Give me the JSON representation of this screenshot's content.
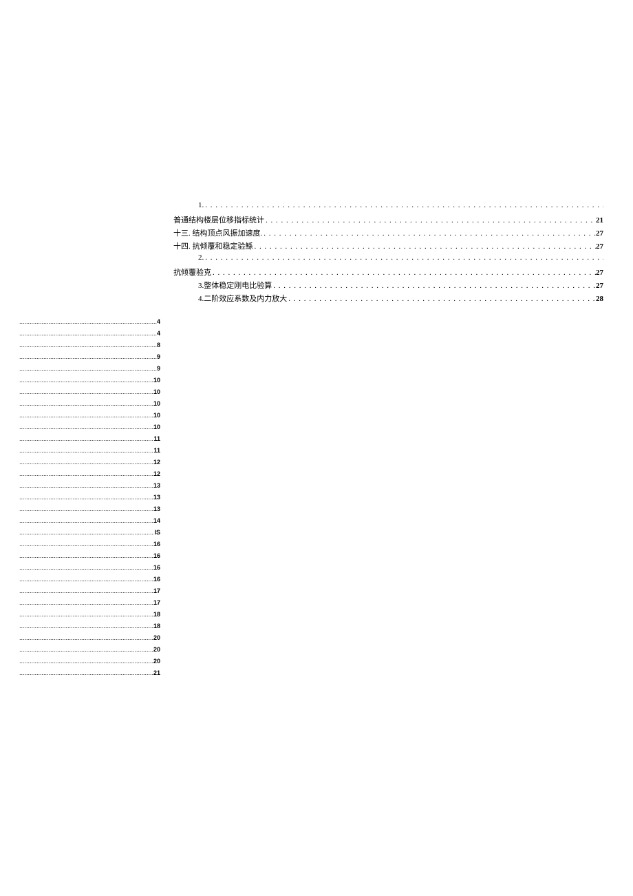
{
  "top_toc": [
    {
      "label": "1.",
      "page": "",
      "indent": 1,
      "nopage": true
    },
    {
      "label": "普通结构楼层位移指标统计",
      "page": "21",
      "indent": 0
    },
    {
      "label": "十三. 结构顶点风振加速度.",
      "page": "27",
      "indent": 0
    },
    {
      "label": "十四. 抗倾覆和稳定验鯀",
      "page": "27",
      "indent": 0
    },
    {
      "label": "2.",
      "page": "",
      "indent": 1,
      "nopage": true
    },
    {
      "label": "抗倾覆验克",
      "page": "27",
      "indent": 0
    },
    {
      "label": "3.整体稳定刚电比验算",
      "page": "27",
      "indent": 2
    },
    {
      "label": "4.二阶效应系数及内力放大",
      "page": "28",
      "indent": 2
    }
  ],
  "left_toc": [
    {
      "page": "4"
    },
    {
      "page": "4"
    },
    {
      "page": "8"
    },
    {
      "page": "9"
    },
    {
      "page": "9"
    },
    {
      "page": "10"
    },
    {
      "page": "10"
    },
    {
      "page": "10"
    },
    {
      "page": "10"
    },
    {
      "page": "10"
    },
    {
      "page": "11"
    },
    {
      "page": "11"
    },
    {
      "page": "12"
    },
    {
      "page": "12"
    },
    {
      "page": "13"
    },
    {
      "page": "13"
    },
    {
      "page": "13"
    },
    {
      "page": "14"
    },
    {
      "page": "IS"
    },
    {
      "page": "16"
    },
    {
      "page": "16"
    },
    {
      "page": "16"
    },
    {
      "page": "16"
    },
    {
      "page": "17"
    },
    {
      "page": "17"
    },
    {
      "page": "18"
    },
    {
      "page": "18"
    },
    {
      "page": "20"
    },
    {
      "page": "20"
    },
    {
      "page": "20"
    },
    {
      "page": "21"
    }
  ],
  "dots_wide": ". . . . . . . . . . . . . . . . . . . . . . . . . . . . . . . . . . . . . . . . . . . . . . . . . . . . . . . . . . . . . . . . . . . . . . . . . . . . . . . . . . . . . . . . . . . . . . . . . . . . . . . . . . . . . . . . . . . . . . . . . . . . . . . . . . . . . . . . . . . . . . . . . . . . . . . . . . . . . . . .",
  "dots_narrow": "..............................................................................................................................................."
}
